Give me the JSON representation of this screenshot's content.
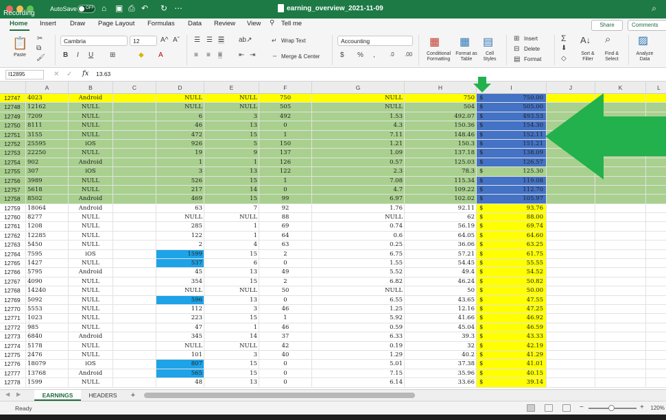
{
  "titlebar": {
    "recording": "Recording",
    "autosave": "AutoSave",
    "autosave_state": "OFF",
    "doc_title": "earning_overview_2021-11-09",
    "search_icon": "search-icon"
  },
  "ribbon": {
    "tabs": [
      "Home",
      "Insert",
      "Draw",
      "Page Layout",
      "Formulas",
      "Data",
      "Review",
      "View",
      "Tell me"
    ],
    "share": "Share",
    "comments": "Comments",
    "paste": "Paste",
    "font_name": "Cambria",
    "font_size": "12",
    "wrap_text": "Wrap Text",
    "merge_center": "Merge & Center",
    "number_format": "Accounting",
    "conditional_formatting": "Conditional Formatting",
    "format_as_table": "Format as Table",
    "cell_styles": "Cell Styles",
    "insert": "Insert",
    "delete": "Delete",
    "format": "Format",
    "sort_filter": "Sort & Filter",
    "find_select": "Find & Select",
    "analyze_data": "Analyze Data"
  },
  "formula_bar": {
    "name_box": "I12895",
    "fx": "fx",
    "value": "13.63"
  },
  "grid": {
    "columns": [
      "A",
      "B",
      "C",
      "D",
      "E",
      "F",
      "G",
      "H",
      "I",
      "J",
      "K",
      "L"
    ],
    "rows": [
      {
        "n": "12747",
        "a": "4023",
        "b": "Android",
        "d": "NULL",
        "e": "NULL",
        "f": "750",
        "g": "NULL",
        "h": "750",
        "i": "750.00",
        "style": "yellow"
      },
      {
        "n": "12748",
        "a": "12162",
        "b": "NULL",
        "d": "NULL",
        "e": "NULL",
        "f": "505",
        "g": "NULL",
        "h": "504",
        "i": "505.00",
        "style": "green"
      },
      {
        "n": "12749",
        "a": "7209",
        "b": "NULL",
        "d": "6",
        "e": "3",
        "f": "492",
        "g": "1.53",
        "h": "492.07",
        "i": "493.53",
        "style": "green"
      },
      {
        "n": "12750",
        "a": "8111",
        "b": "NULL",
        "d": "46",
        "e": "13",
        "f": "0",
        "g": "4.3",
        "h": "150.36",
        "i": "154.30",
        "style": "green"
      },
      {
        "n": "12751",
        "a": "3155",
        "b": "NULL",
        "d": "472",
        "e": "15",
        "f": "1",
        "g": "7.11",
        "h": "148.46",
        "i": "152.11",
        "style": "green"
      },
      {
        "n": "12752",
        "a": "25595",
        "b": "iOS",
        "d": "926",
        "e": "5",
        "f": "150",
        "g": "1.21",
        "h": "150.3",
        "i": "151.21",
        "style": "green"
      },
      {
        "n": "12753",
        "a": "22250",
        "b": "NULL",
        "d": "19",
        "e": "9",
        "f": "137",
        "g": "1.09",
        "h": "137.18",
        "i": "138.09",
        "style": "green"
      },
      {
        "n": "12754",
        "a": "902",
        "b": "Android",
        "d": "1",
        "e": "1",
        "f": "126",
        "g": "0.57",
        "h": "125.03",
        "i": "126.57",
        "style": "green"
      },
      {
        "n": "12755",
        "a": "307",
        "b": "iOS",
        "d": "3",
        "e": "13",
        "f": "122",
        "g": "2.3",
        "h": "78.3",
        "i": "125.30",
        "style": "green-plain"
      },
      {
        "n": "12756",
        "a": "3989",
        "b": "NULL",
        "d": "526",
        "e": "15",
        "f": "1",
        "g": "7.08",
        "h": "115.34",
        "i": "119.08",
        "style": "green"
      },
      {
        "n": "12757",
        "a": "5618",
        "b": "NULL",
        "d": "217",
        "e": "14",
        "f": "0",
        "g": "4.7",
        "h": "109.22",
        "i": "112.70",
        "style": "green"
      },
      {
        "n": "12758",
        "a": "8502",
        "b": "Android",
        "d": "469",
        "e": "15",
        "f": "99",
        "g": "6.97",
        "h": "102.02",
        "i": "105.97",
        "style": "green"
      },
      {
        "n": "12759",
        "a": "18064",
        "b": "Android",
        "d": "63",
        "e": "7",
        "f": "92",
        "g": "1.76",
        "h": "92.11",
        "i": "93.76",
        "style": "plain"
      },
      {
        "n": "12760",
        "a": "8277",
        "b": "NULL",
        "d": "NULL",
        "e": "NULL",
        "f": "88",
        "g": "NULL",
        "h": "62",
        "i": "88.00",
        "style": "plain"
      },
      {
        "n": "12761",
        "a": "1208",
        "b": "NULL",
        "d": "285",
        "e": "1",
        "f": "69",
        "g": "0.74",
        "h": "56.19",
        "i": "69.74",
        "style": "plain"
      },
      {
        "n": "12762",
        "a": "12285",
        "b": "NULL",
        "d": "122",
        "e": "1",
        "f": "64",
        "g": "0.6",
        "h": "64.05",
        "i": "64.60",
        "style": "plain"
      },
      {
        "n": "12763",
        "a": "5450",
        "b": "NULL",
        "d": "2",
        "e": "4",
        "f": "63",
        "g": "0.25",
        "h": "36.06",
        "i": "63.25",
        "style": "plain"
      },
      {
        "n": "12764",
        "a": "7595",
        "b": "iOS",
        "d": "1599",
        "e": "15",
        "f": "2",
        "g": "6.75",
        "h": "57.21",
        "i": "61.75",
        "style": "plain",
        "dblue": true
      },
      {
        "n": "12765",
        "a": "1427",
        "b": "NULL",
        "d": "537",
        "e": "6",
        "f": "0",
        "g": "1.55",
        "h": "54.45",
        "i": "55.55",
        "style": "plain",
        "dblue": true
      },
      {
        "n": "12766",
        "a": "5795",
        "b": "Android",
        "d": "45",
        "e": "13",
        "f": "49",
        "g": "5.52",
        "h": "49.4",
        "i": "54.52",
        "style": "plain"
      },
      {
        "n": "12767",
        "a": "4090",
        "b": "NULL",
        "d": "354",
        "e": "15",
        "f": "2",
        "g": "6.82",
        "h": "46.24",
        "i": "50.82",
        "style": "plain"
      },
      {
        "n": "12768",
        "a": "14240",
        "b": "NULL",
        "d": "NULL",
        "e": "NULL",
        "f": "50",
        "g": "NULL",
        "h": "50",
        "i": "50.00",
        "style": "plain"
      },
      {
        "n": "12769",
        "a": "5092",
        "b": "NULL",
        "d": "596",
        "e": "13",
        "f": "0",
        "g": "6.55",
        "h": "43.65",
        "i": "47.55",
        "style": "plain",
        "dblue": true
      },
      {
        "n": "12770",
        "a": "5553",
        "b": "NULL",
        "d": "112",
        "e": "3",
        "f": "46",
        "g": "1.25",
        "h": "12.16",
        "i": "47.25",
        "style": "plain"
      },
      {
        "n": "12771",
        "a": "1023",
        "b": "NULL",
        "d": "223",
        "e": "15",
        "f": "1",
        "g": "5.92",
        "h": "41.66",
        "i": "46.92",
        "style": "plain"
      },
      {
        "n": "12772",
        "a": "985",
        "b": "NULL",
        "d": "47",
        "e": "1",
        "f": "46",
        "g": "0.59",
        "h": "45.04",
        "i": "46.59",
        "style": "plain"
      },
      {
        "n": "12773",
        "a": "6840",
        "b": "Android",
        "d": "345",
        "e": "14",
        "f": "37",
        "g": "6.33",
        "h": "39.3",
        "i": "43.33",
        "style": "plain"
      },
      {
        "n": "12774",
        "a": "5178",
        "b": "NULL",
        "d": "NULL",
        "e": "NULL",
        "f": "42",
        "g": "0.19",
        "h": "32",
        "i": "42.19",
        "style": "plain"
      },
      {
        "n": "12775",
        "a": "2476",
        "b": "NULL",
        "d": "101",
        "e": "3",
        "f": "40",
        "g": "1.29",
        "h": "40.2",
        "i": "41.29",
        "style": "plain"
      },
      {
        "n": "12776",
        "a": "18079",
        "b": "iOS",
        "d": "807",
        "e": "15",
        "f": "0",
        "g": "5.01",
        "h": "37.38",
        "i": "41.01",
        "style": "plain",
        "dblue": true
      },
      {
        "n": "12777",
        "a": "13768",
        "b": "Android",
        "d": "565",
        "e": "15",
        "f": "0",
        "g": "7.15",
        "h": "35.96",
        "i": "40.15",
        "style": "plain",
        "dblue": true
      },
      {
        "n": "12778",
        "a": "1599",
        "b": "NULL",
        "d": "48",
        "e": "13",
        "f": "0",
        "g": "6.14",
        "h": "33.66",
        "i": "39.14",
        "style": "plain"
      }
    ],
    "dollar": "$"
  },
  "sheets": {
    "tabs": [
      "EARNINGS",
      "HEADERS"
    ],
    "add": "+"
  },
  "status": {
    "ready": "Ready",
    "zoom": "120%"
  },
  "colors": {
    "green_title": "#1d7a45",
    "row_yellow": "#ffff00",
    "row_green": "#a9d08e",
    "cell_blue": "#4472c4",
    "cell_lightblue": "#1ea3e8",
    "arrow_green": "#22b14c"
  }
}
